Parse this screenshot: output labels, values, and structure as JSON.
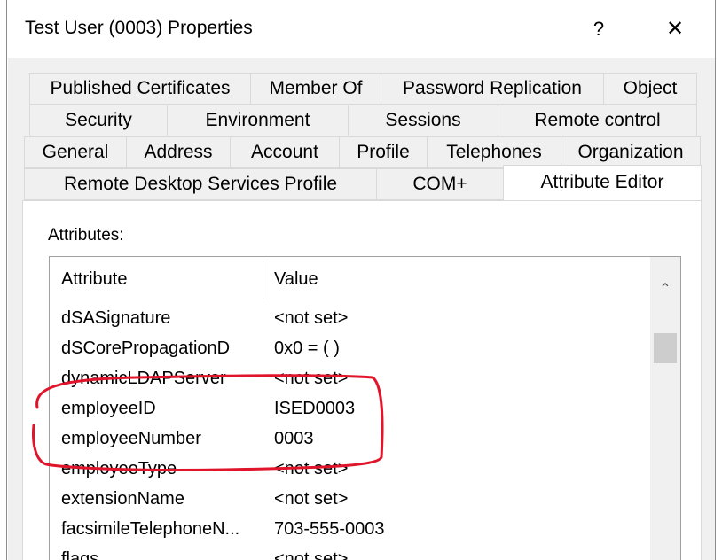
{
  "window": {
    "title": "Test User (0003) Properties",
    "help_label": "?",
    "close_label": "✕"
  },
  "tabs": {
    "row1": [
      "Published Certificates",
      "Member Of",
      "Password Replication",
      "Object"
    ],
    "row2": [
      "Security",
      "Environment",
      "Sessions",
      "Remote control"
    ],
    "row3": [
      "General",
      "Address",
      "Account",
      "Profile",
      "Telephones",
      "Organization"
    ],
    "row4": [
      "Remote Desktop Services Profile",
      "COM+",
      "Attribute Editor"
    ],
    "active": "Attribute Editor"
  },
  "attributes": {
    "caption": "Attributes:",
    "columns": {
      "attribute": "Attribute",
      "value": "Value"
    },
    "rows": [
      {
        "attribute": "dSASignature",
        "value": "<not set>"
      },
      {
        "attribute": "dSCorePropagationD",
        "value": "0x0 = ( )"
      },
      {
        "attribute": "dynamicLDAPServer",
        "value": "<not set>"
      },
      {
        "attribute": "employeeID",
        "value": "ISED0003"
      },
      {
        "attribute": "employeeNumber",
        "value": "0003"
      },
      {
        "attribute": "employeeType",
        "value": "<not set>"
      },
      {
        "attribute": "extensionName",
        "value": "<not set>"
      },
      {
        "attribute": "facsimileTelephoneN...",
        "value": "703-555-0003"
      },
      {
        "attribute": "flags",
        "value": "<not set>"
      }
    ]
  },
  "colors": {
    "highlight": "#e0142a",
    "background": "#f0f0f0"
  },
  "icons": {
    "scroll_up": "chevron-up-icon"
  }
}
